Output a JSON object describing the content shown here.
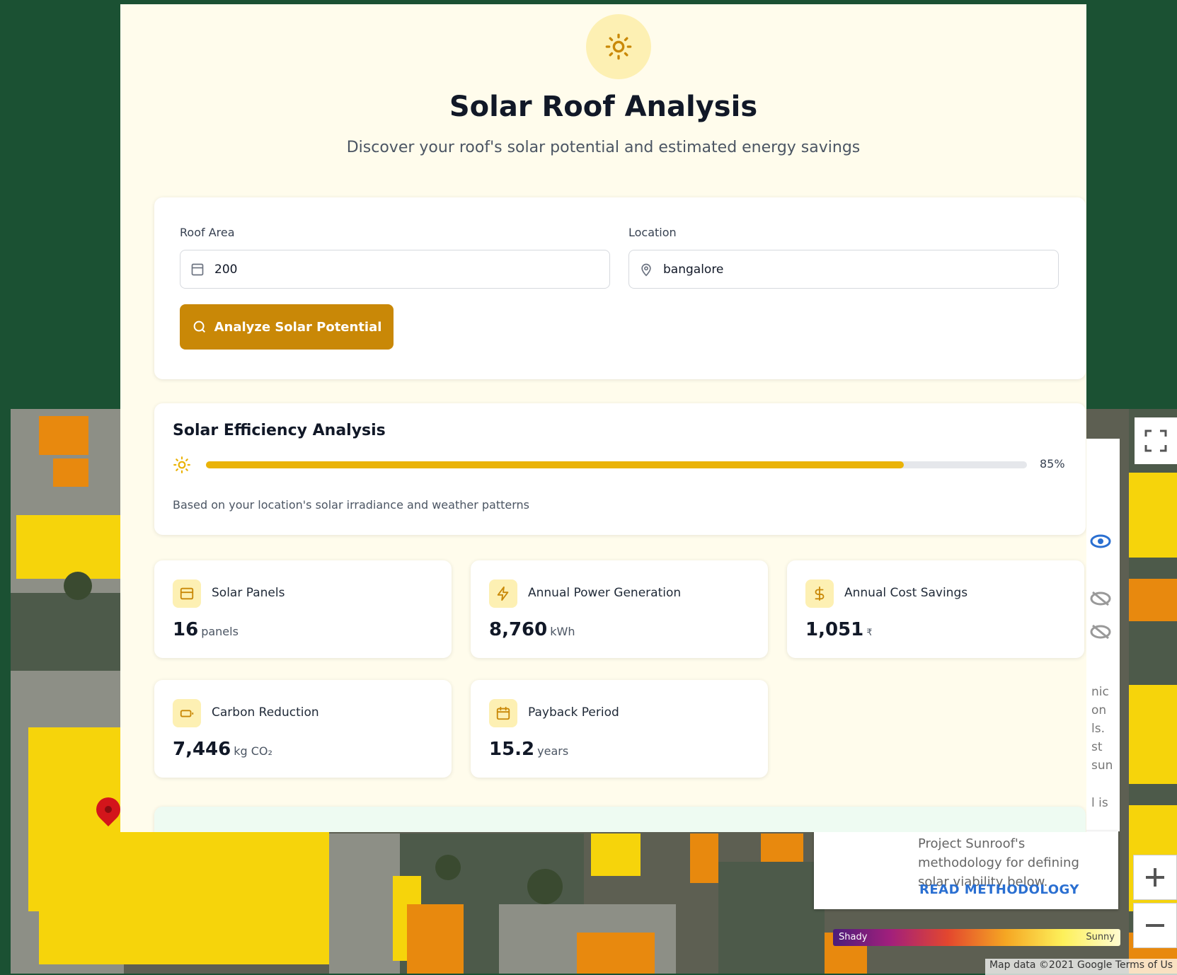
{
  "header": {
    "title": "Solar Roof Analysis",
    "subtitle": "Discover your roof's solar potential and estimated energy savings"
  },
  "form": {
    "roof_area_label": "Roof Area",
    "roof_area_value": "200",
    "location_label": "Location",
    "location_value": "bangalore",
    "analyze_label": "Analyze Solar Potential"
  },
  "efficiency": {
    "title": "Solar Efficiency Analysis",
    "value_percent": 85,
    "label": "85%",
    "note": "Based on your location's solar irradiance and weather patterns"
  },
  "stats": [
    {
      "icon": "solar-panel-icon",
      "label": "Solar Panels",
      "value": "16",
      "unit": "panels"
    },
    {
      "icon": "bolt-icon",
      "label": "Annual Power Generation",
      "value": "8,760",
      "unit": "kWh"
    },
    {
      "icon": "dollar-icon",
      "label": "Annual Cost Savings",
      "value": "1,051",
      "unit": "₹"
    },
    {
      "icon": "battery-icon",
      "label": "Carbon Reduction",
      "value": "7,446",
      "unit": "kg CO₂"
    },
    {
      "icon": "calendar-icon",
      "label": "Payback Period",
      "value": "15.2",
      "unit": "years"
    }
  ],
  "map": {
    "card_text": "Project Sunroof's methodology for defining solar viability below.",
    "card_link": "READ METHODOLOGY",
    "legend_left": "Shady",
    "legend_right": "Sunny",
    "attribution": "Map data ©2021 Google   Terms of Us",
    "strip_fragments": [
      "nic",
      "on",
      "ls.",
      "st",
      "sun",
      "l is"
    ]
  },
  "colors": {
    "accent": "#c98807",
    "progress": "#eab308",
    "background": "#1b5133",
    "panel": "#fffcec"
  }
}
